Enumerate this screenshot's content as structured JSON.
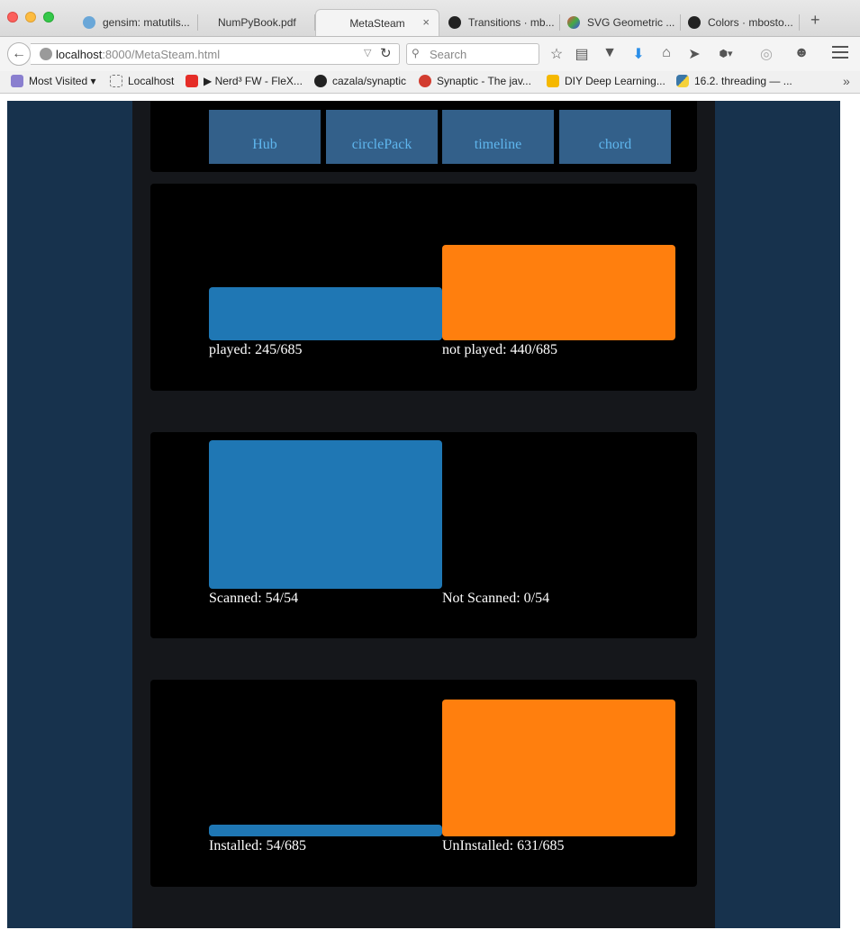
{
  "browser": {
    "tabs": [
      {
        "title": "gensim: matutils...",
        "active": false
      },
      {
        "title": "NumPyBook.pdf",
        "active": false
      },
      {
        "title": "MetaSteam",
        "active": true
      },
      {
        "title": "Transitions · mb...",
        "active": false
      },
      {
        "title": "SVG Geometric ...",
        "active": false
      },
      {
        "title": "Colors · mbosto...",
        "active": false
      }
    ],
    "new_tab_label": "+",
    "close_tab_label": "×",
    "url_host": "localhost",
    "url_rest": ":8000/MetaSteam.html",
    "search_placeholder": "Search",
    "bookmarks": [
      {
        "label": "Most Visited ▾"
      },
      {
        "label": "Localhost"
      },
      {
        "label": "▶ Nerd³ FW - FleX..."
      },
      {
        "label": "cazala/synaptic"
      },
      {
        "label": "Synaptic - The jav..."
      },
      {
        "label": "DIY Deep Learning..."
      },
      {
        "label": "16.2. threading — ..."
      }
    ],
    "more_label": "»"
  },
  "page": {
    "nav": [
      "Hub",
      "circlePack",
      "timeline",
      "chord"
    ]
  },
  "colors": {
    "first_bar": "#1f77b4",
    "second_bar": "#ff7f0e",
    "nav_bg": "#33608a",
    "nav_text": "#5fb6ee"
  },
  "chart_data": [
    {
      "type": "bar",
      "categories": [
        "played",
        "not played"
      ],
      "values": [
        245,
        440
      ],
      "total": 685,
      "labels": [
        "played: 245/685",
        "not played: 440/685"
      ]
    },
    {
      "type": "bar",
      "categories": [
        "Scanned",
        "Not Scanned"
      ],
      "values": [
        54,
        0
      ],
      "total": 54,
      "labels": [
        "Scanned: 54/54",
        "Not Scanned: 0/54"
      ]
    },
    {
      "type": "bar",
      "categories": [
        "Installed",
        "UnInstalled"
      ],
      "values": [
        54,
        631
      ],
      "total": 685,
      "labels": [
        "Installed: 54/685",
        "UnInstalled: 631/685"
      ]
    }
  ]
}
